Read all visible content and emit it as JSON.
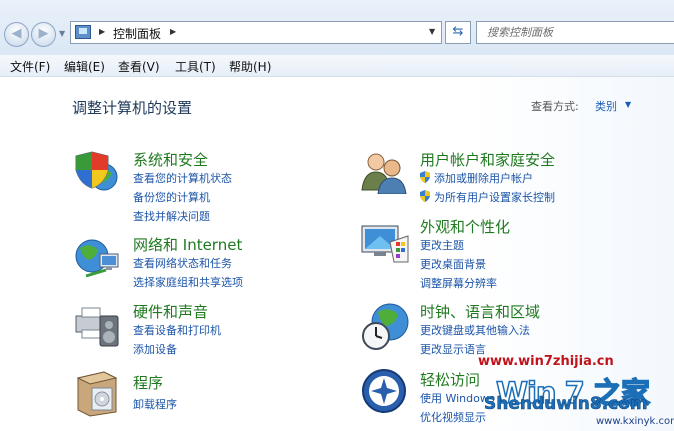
{
  "address": {
    "crumb": "控制面板",
    "search_placeholder": "搜索控制面板"
  },
  "menu": [
    "文件(F)",
    "编辑(E)",
    "查看(V)",
    "工具(T)",
    "帮助(H)"
  ],
  "main": {
    "title": "调整计算机的设置",
    "view_by_label": "查看方式:",
    "view_by_value": "类别"
  },
  "categories": [
    {
      "title": "系统和安全",
      "icon": "shield-globe-icon",
      "links": [
        "查看您的计算机状态",
        "备份您的计算机",
        "查找并解决问题"
      ]
    },
    {
      "title": "网络和 Internet",
      "icon": "network-globe-icon",
      "links": [
        "查看网络状态和任务",
        "选择家庭组和共享选项"
      ]
    },
    {
      "title": "硬件和声音",
      "icon": "printer-speaker-icon",
      "links": [
        "查看设备和打印机",
        "添加设备"
      ]
    },
    {
      "title": "程序",
      "icon": "programs-box-icon",
      "links": [
        "卸载程序"
      ]
    },
    {
      "title": "用户帐户和家庭安全",
      "icon": "users-icon",
      "links": [
        "添加或删除用户帐户",
        "为所有用户设置家长控制"
      ]
    },
    {
      "title": "外观和个性化",
      "icon": "monitor-palette-icon",
      "links": [
        "更改主题",
        "更改桌面背景",
        "调整屏幕分辨率"
      ]
    },
    {
      "title": "时钟、语言和区域",
      "icon": "clock-globe-icon",
      "links": [
        "更改键盘或其他输入法",
        "更改显示语言"
      ]
    },
    {
      "title": "轻松访问",
      "icon": "ease-of-access-icon",
      "links": [
        "使用 Windows",
        "优化视频显示"
      ]
    }
  ],
  "watermark": {
    "site1": "www.win7zhijia.cn",
    "logo": "Win 7 之家",
    "site2": "Shenduwin8.com",
    "site3": "www.kxinyk.com"
  },
  "colors": {
    "category_title": "#1f7a1f",
    "link": "#1c55a8",
    "page_title": "#1e395b"
  }
}
